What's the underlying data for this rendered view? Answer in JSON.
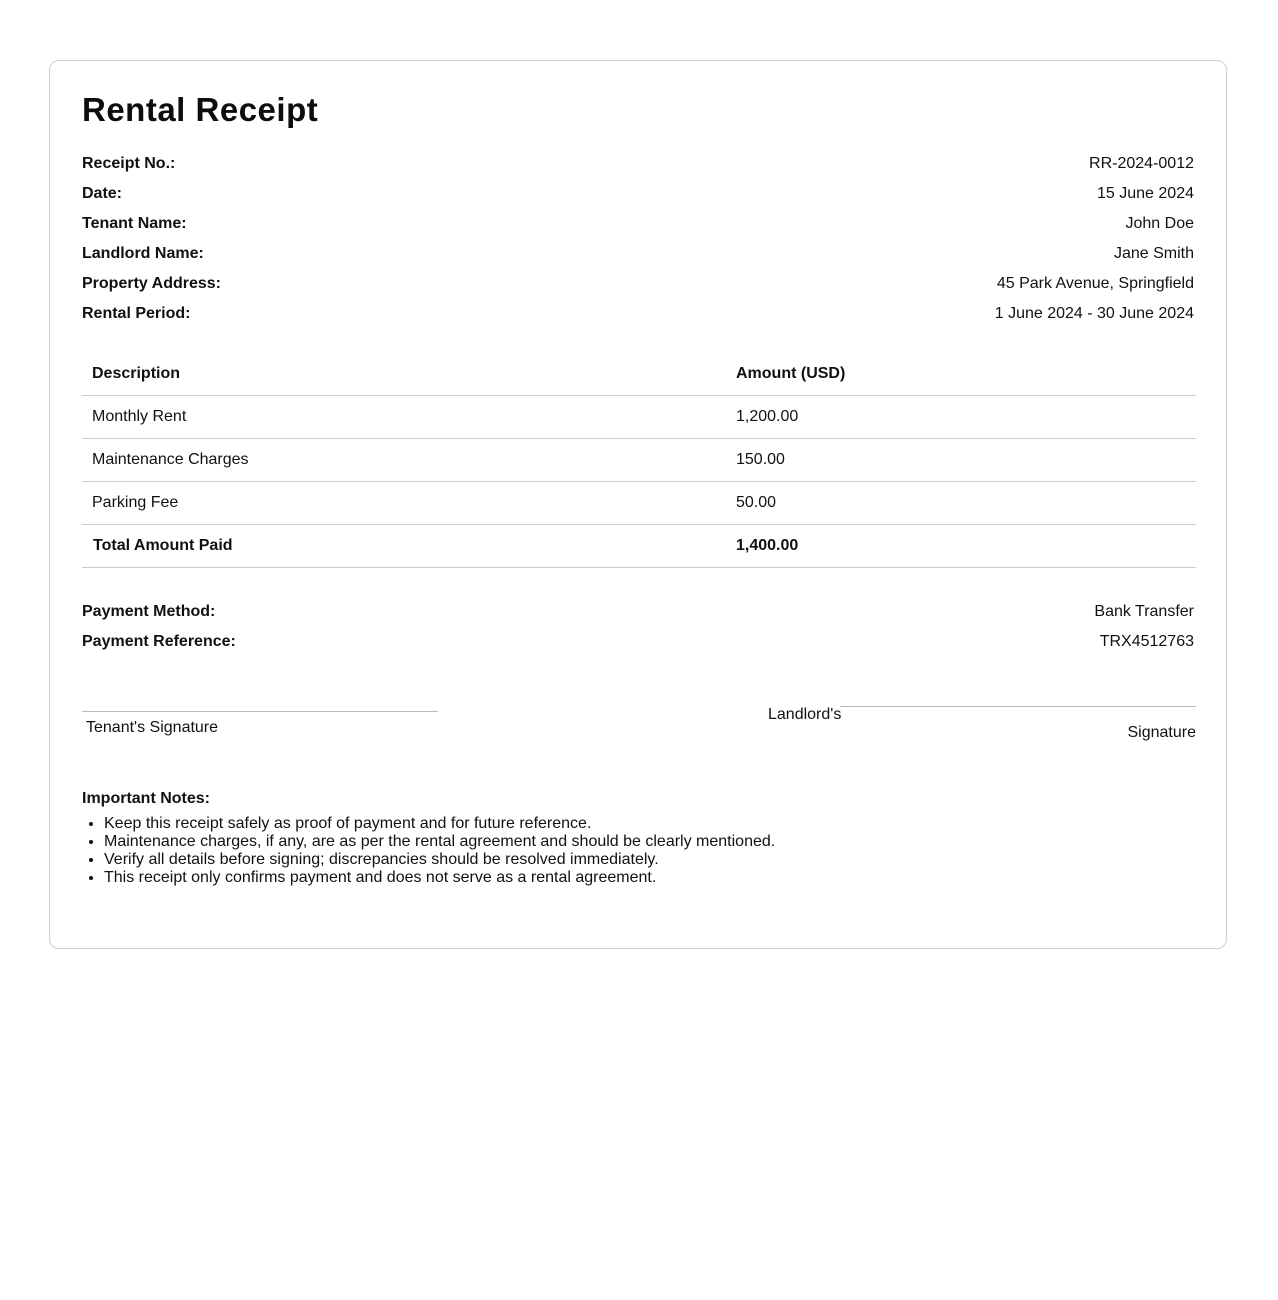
{
  "receipt": {
    "title": "Rental Receipt",
    "details": [
      {
        "label": "Receipt No.:",
        "value": "RR-2024-0012"
      },
      {
        "label": "Date:",
        "value": "15 June 2024"
      },
      {
        "label": "Tenant Name:",
        "value": "John Doe"
      },
      {
        "label": "Landlord Name:",
        "value": "Jane Smith"
      },
      {
        "label": "Property Address:",
        "value": "45 Park Avenue, Springfield"
      },
      {
        "label": "Rental Period:",
        "value": "1 June 2024 - 30 June 2024"
      }
    ],
    "table": {
      "headers": [
        "Description",
        "Amount (USD)"
      ],
      "rows": [
        {
          "description": "Monthly Rent",
          "amount": "1,200.00"
        },
        {
          "description": "Maintenance Charges",
          "amount": "150.00"
        },
        {
          "description": "Parking Fee",
          "amount": "50.00"
        }
      ],
      "total": {
        "description": "Total Amount Paid",
        "amount": "1,400.00"
      }
    },
    "payment": [
      {
        "label": "Payment Method:",
        "value": "Bank Transfer"
      },
      {
        "label": "Payment Reference:",
        "value": "TRX4512763"
      }
    ],
    "signatures": {
      "tenant": "Tenant's Signature",
      "landlord_line1": "Landlord's",
      "landlord_line2": "Signature"
    },
    "notes": {
      "title": "Important Notes:",
      "items": [
        "Keep this receipt safely as proof of payment and for future reference.",
        "Maintenance charges, if any, are as per the rental agreement and should be clearly mentioned.",
        "Verify all details before signing; discrepancies should be resolved immediately.",
        "This receipt only confirms payment and does not serve as a rental agreement."
      ]
    }
  }
}
